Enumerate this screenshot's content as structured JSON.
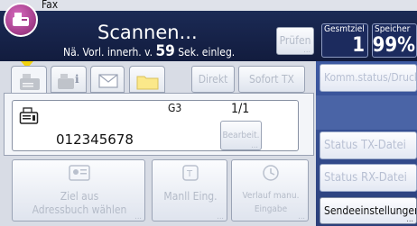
{
  "app": {
    "title": "Fax"
  },
  "header": {
    "status_main": "Scannen...",
    "status_sub_prefix": "Nä. Vorl. innerh. v.",
    "status_sub_number": "59",
    "status_sub_suffix": "Sek. einleg.",
    "check_label": "Prüfen",
    "total_label": "Gesmtziel",
    "total_value": "1",
    "memory_label": "Speicher",
    "memory_value": "99%"
  },
  "tabs": {
    "direct_label": "Direkt",
    "immediate_label": "Sofort TX"
  },
  "destination": {
    "line_type": "G3",
    "page_count": "1/1",
    "number": "012345678",
    "edit_label": "Bearbeit."
  },
  "bottom": {
    "addressbook_line1": "Ziel aus",
    "addressbook_line2": "Adressbuch wählen",
    "manual_label": "Manll Eing.",
    "history_line1": "Verlauf manu.",
    "history_line2": "Eingabe"
  },
  "side": {
    "comm_status": "Komm.status/Druck.",
    "tx_status": "Status TX-Datei",
    "rx_status": "Status RX-Datei",
    "send_settings": "Sendeeinstellungen"
  },
  "colors": {
    "header_dark": "#16234a",
    "right_panel": "#2f4683",
    "fax_logo": "#a43e8b"
  }
}
